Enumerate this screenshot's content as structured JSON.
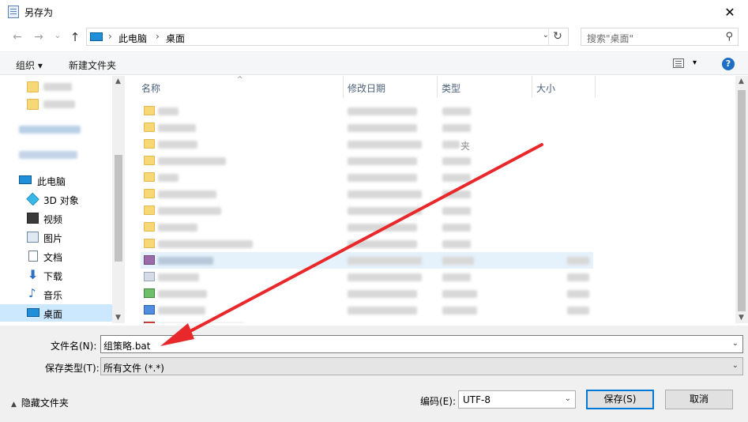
{
  "window": {
    "title": "另存为",
    "close_glyph": "✕"
  },
  "nav": {
    "back_glyph": "←",
    "forward_glyph": "→",
    "recent_glyph": "⌄",
    "up_glyph": "↑",
    "breadcrumb": [
      "此电脑",
      "桌面"
    ],
    "breadcrumb_sep": "›",
    "refresh_glyph": "↻",
    "search_placeholder": "搜索\"桌面\"",
    "search_icon": "search-icon"
  },
  "toolbar": {
    "organize_label": "组织 ▾",
    "new_folder_label": "新建文件夹",
    "view_dd_glyph": "▾",
    "help_glyph": "?"
  },
  "sidebar": {
    "items": [
      {
        "label": "此电脑",
        "icon": "computer-icon"
      },
      {
        "label": "3D 对象",
        "icon": "cube-icon"
      },
      {
        "label": "视频",
        "icon": "video-icon"
      },
      {
        "label": "图片",
        "icon": "pictures-icon"
      },
      {
        "label": "文档",
        "icon": "document-icon"
      },
      {
        "label": "下载",
        "icon": "download-icon"
      },
      {
        "label": "音乐",
        "icon": "music-icon"
      },
      {
        "label": "桌面",
        "icon": "desktop-icon",
        "selected": true
      }
    ]
  },
  "filelist": {
    "columns": [
      "名称",
      "修改日期",
      "类型",
      "大小"
    ],
    "sort_glyph": "^",
    "visible_partial_text": "夹"
  },
  "form": {
    "filename_label": "文件名(N):",
    "filename_value": "组策略.bat",
    "filetype_label": "保存类型(T):",
    "filetype_value": "所有文件  (*.*)",
    "encoding_label": "编码(E):",
    "encoding_value": "UTF-8",
    "save_label": "保存(S)",
    "cancel_label": "取消",
    "hide_folders_label": "隐藏文件夹",
    "dropdown_glyph": "⌄"
  },
  "colors": {
    "selection": "#cce8ff",
    "primary_border": "#0078d7",
    "annotation_red": "#e8282b"
  }
}
